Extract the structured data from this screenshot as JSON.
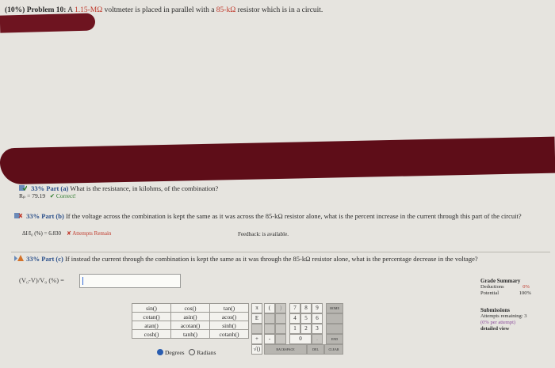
{
  "header": {
    "percent": "(10%)",
    "problem": "Problem 10:",
    "text_a": "A ",
    "value_red": "1.15-MΩ",
    "text_b": " voltmeter is placed in parallel with a ",
    "value_red2": "85-kΩ",
    "text_c": " resistor which is in a circuit."
  },
  "part_a": {
    "weight": "33% Part (a)",
    "question": "What is the resistance, in kilohms, of the combination?",
    "answer": "Rₚ = 79.19",
    "status": "✔ Correct!"
  },
  "part_b": {
    "weight": "33% Part (b)",
    "question": "If the voltage across the combination is kept the same as it was across the 85-kΩ resistor alone, what is the percent increase in the current through this part of the circuit?",
    "answer": "ΔI/I₀ (%) = 6.830",
    "status": "✘ Attempts Remain",
    "feedback": "Feedback: is available."
  },
  "part_c": {
    "weight": "33% Part (c)",
    "question": "If instead the current through the combination is kept the same as it was through the 85-kΩ resistor alone, what is the percentage decrease in the voltage?",
    "answer_label": "(V₀-V)/V₀ (%) ="
  },
  "grade": {
    "title": "Grade Summary",
    "deductions": "Deductions",
    "deductions_val": "0%",
    "potential": "Potential",
    "potential_val": "100%"
  },
  "submissions": {
    "title": "Submissions",
    "line1": "Attempts remaining: 3",
    "line2": "(0% per attempt)",
    "line3": "detailed view"
  },
  "functions": [
    [
      "sin()",
      "cos()",
      "tan()"
    ],
    [
      "cotan()",
      "asin()",
      "acos()"
    ],
    [
      "atan()",
      "acotan()",
      "sinh()"
    ],
    [
      "cosh()",
      "tanh()",
      "cotanh()"
    ]
  ],
  "angle": {
    "degrees": "Degrees",
    "radians": "Radians"
  },
  "keypad": {
    "pi": "π",
    "lparen": "(",
    "rparen": ")",
    "e": "E",
    "sqrt": "√()",
    "plus": "+",
    "minus": "-",
    "n7": "7",
    "n8": "8",
    "n9": "9",
    "n4": "4",
    "n5": "5",
    "n6": "6",
    "n1": "1",
    "n2": "2",
    "n3": "3",
    "n0": "0",
    "home": "HOME",
    "end": "END",
    "backspace": "BACKSPACE",
    "del": "DEL",
    "clear": "CLEAR",
    "dot": "."
  }
}
